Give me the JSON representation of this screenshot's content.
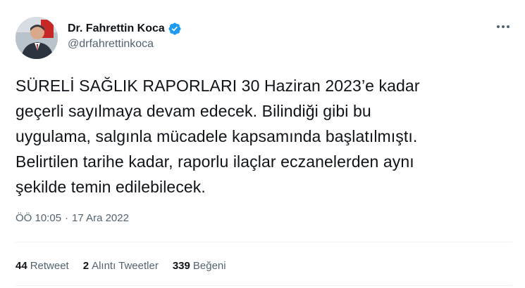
{
  "author": {
    "display_name": "Dr. Fahrettin Koca",
    "handle": "@drfahrettinkoca",
    "verified": true,
    "avatar_icon": "profile-photo",
    "verified_color": "#1d9bf0"
  },
  "more_icon": "more-horizontal-icon",
  "tweet": {
    "text": "SÜRELİ SAĞLIK RAPORLARI 30 Haziran 2023’e kadar\ngeçerli sayılmaya devam edecek. Bilindiği gibi bu\nuygulama, salgınla mücadele kapsamında başlatılmıştı.\nBelirtilen tarihe kadar, raporlu ilaçlar eczanelerden aynı\nşekilde temin edilebilecek.",
    "time": "ÖÖ 10:05",
    "separator": "·",
    "date": "17 Ara 2022"
  },
  "stats": {
    "retweets": {
      "count": "44",
      "label": "Retweet"
    },
    "quotes": {
      "count": "2",
      "label": "Alıntı Tweetler"
    },
    "likes": {
      "count": "339",
      "label": "Beğeni"
    }
  },
  "colors": {
    "text_primary": "#0f1419",
    "text_secondary": "#536471",
    "divider": "#eff3f4"
  }
}
